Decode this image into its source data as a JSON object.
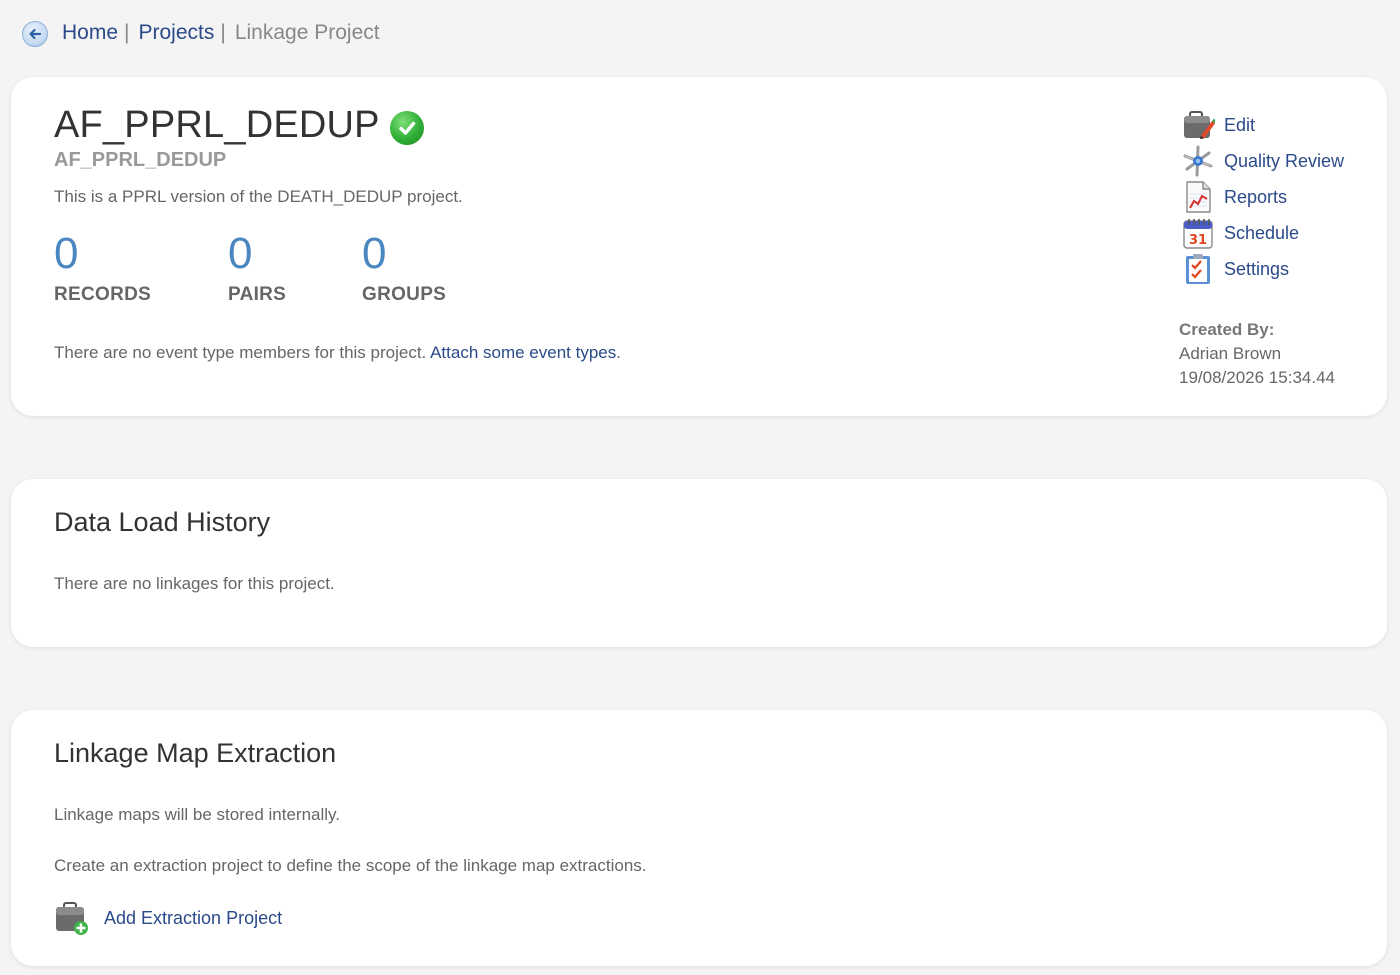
{
  "breadcrumb": {
    "home": "Home",
    "projects": "Projects",
    "current": "Linkage Project",
    "separator": "|"
  },
  "project": {
    "title": "AF_PPRL_DEDUP",
    "subtitle": "AF_PPRL_DEDUP",
    "description": "This is a PPRL version of the DEATH_DEDUP project.",
    "status_icon": "check-circle-icon",
    "stats": [
      {
        "value": "0",
        "label": "RECORDS"
      },
      {
        "value": "0",
        "label": "PAIRS"
      },
      {
        "value": "0",
        "label": "GROUPS"
      }
    ],
    "events_message": "There are no event type members for this project.",
    "events_link": "Attach some event types",
    "events_period": "."
  },
  "actions": [
    {
      "label": "Edit",
      "icon": "edit-briefcase-icon"
    },
    {
      "label": "Quality Review",
      "icon": "quality-review-icon"
    },
    {
      "label": "Reports",
      "icon": "reports-chart-icon"
    },
    {
      "label": "Schedule",
      "icon": "calendar-icon"
    },
    {
      "label": "Settings",
      "icon": "settings-checklist-icon"
    }
  ],
  "created": {
    "title": "Created By:",
    "name": "Adrian Brown",
    "timestamp": "19/08/2026 15:34.44"
  },
  "data_load_history": {
    "title": "Data Load History",
    "message": "There are no linkages for this project."
  },
  "linkage_map_extraction": {
    "title": "Linkage Map Extraction",
    "storage_message": "Linkage maps will be stored internally.",
    "create_message": "Create an extraction project to define the scope of the linkage map extractions.",
    "add_label": "Add Extraction Project"
  },
  "colors": {
    "link": "#2a4a8a",
    "stat_number": "#4a86c0",
    "page_background": "#f4f4f4"
  }
}
